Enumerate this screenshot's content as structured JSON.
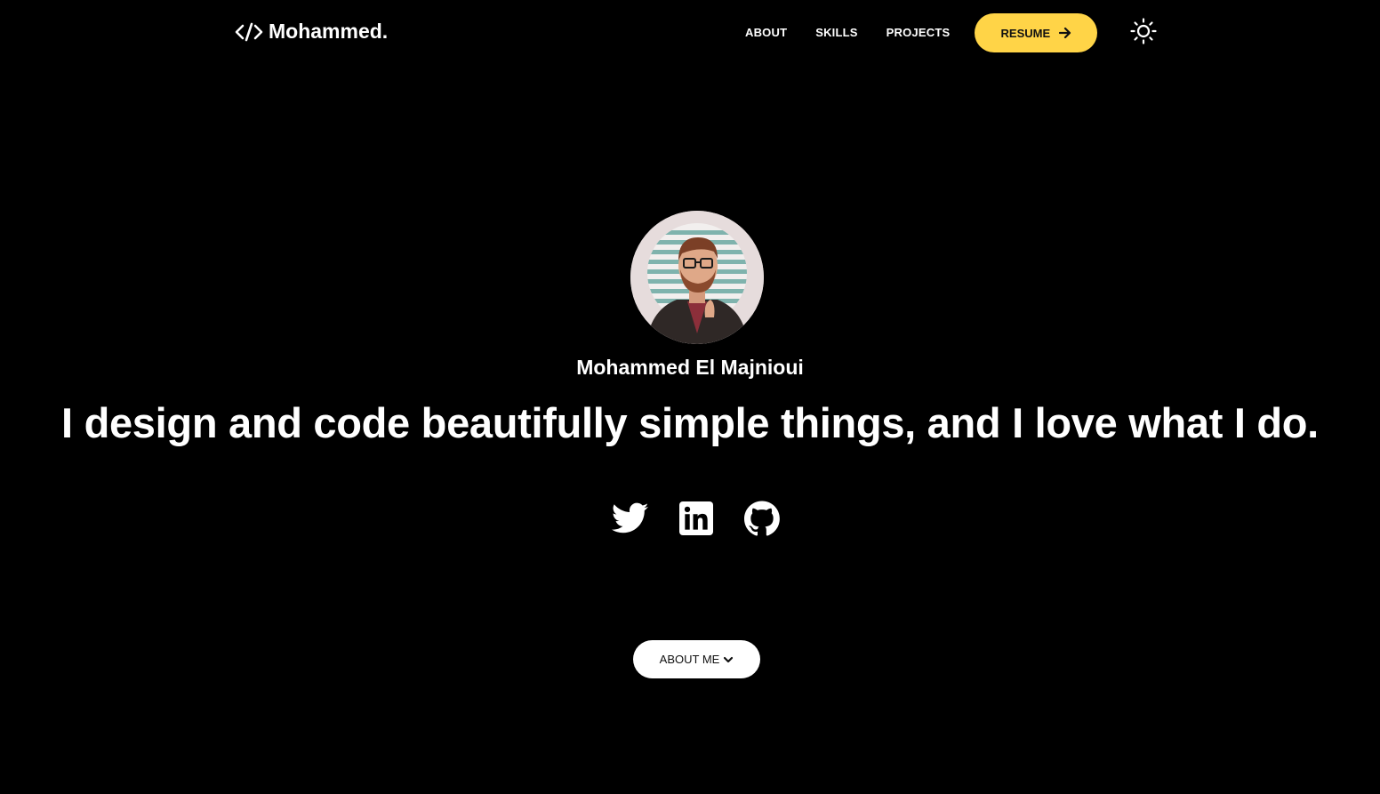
{
  "header": {
    "logo_text": "Mohammed.",
    "logo_icon": "code-icon",
    "nav": [
      {
        "label": "ABOUT"
      },
      {
        "label": "SKILLS"
      },
      {
        "label": "PROJECTS"
      }
    ],
    "resume_label": "RESUME",
    "resume_icon": "arrow-right-icon",
    "theme_toggle_icon": "sun-icon"
  },
  "hero": {
    "avatar_icon": "avatar-illustration",
    "name": "Mohammed El Majnioui",
    "tagline": "I design and code beautifully simple things, and I love what I do.",
    "socials": [
      {
        "icon": "twitter-icon"
      },
      {
        "icon": "linkedin-icon"
      },
      {
        "icon": "github-icon"
      }
    ],
    "about_button_label": "ABOUT ME",
    "about_button_icon": "chevron-down-icon"
  },
  "colors": {
    "background": "#000000",
    "text": "#ffffff",
    "accent": "#ffd447",
    "button_light": "#ffffff"
  }
}
